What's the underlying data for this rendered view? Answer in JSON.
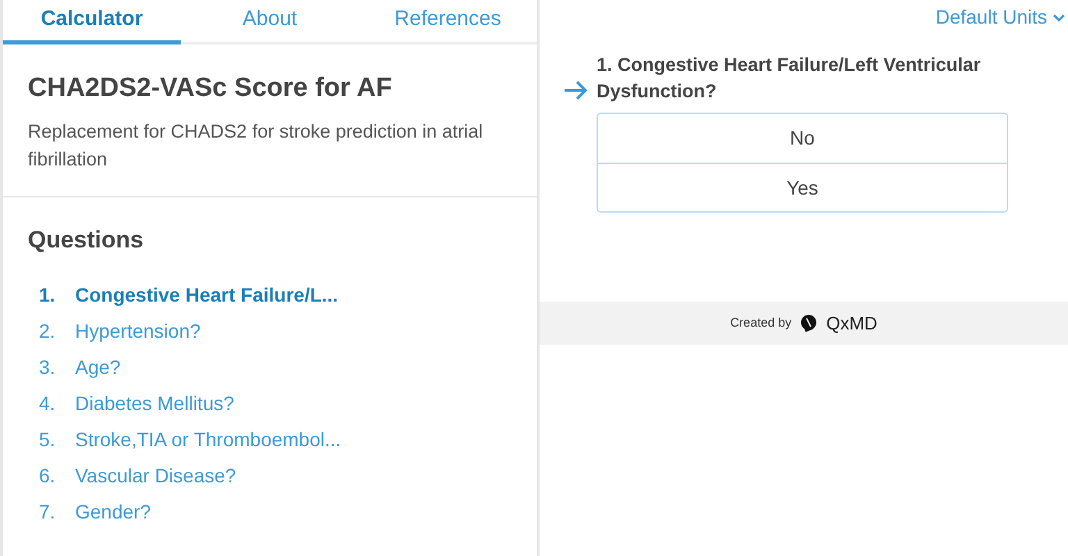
{
  "tabs": [
    {
      "label": "Calculator",
      "selected": true
    },
    {
      "label": "About",
      "selected": false
    },
    {
      "label": "References",
      "selected": false
    }
  ],
  "calculator": {
    "title": "CHA2DS2-VASc Score for AF",
    "description": "Replacement for CHADS2 for stroke prediction in atrial fibrillation"
  },
  "questions": {
    "heading": "Questions",
    "items": [
      {
        "number": "1.",
        "label": "Congestive Heart Failure/L...",
        "selected": true
      },
      {
        "number": "2.",
        "label": "Hypertension?",
        "selected": false
      },
      {
        "number": "3.",
        "label": "Age?",
        "selected": false
      },
      {
        "number": "4.",
        "label": "Diabetes Mellitus?",
        "selected": false
      },
      {
        "number": "5.",
        "label": "Stroke,TIA or Thromboembol...",
        "selected": false
      },
      {
        "number": "6.",
        "label": "Vascular Disease?",
        "selected": false
      },
      {
        "number": "7.",
        "label": "Gender?",
        "selected": false
      }
    ]
  },
  "units_menu": {
    "label": "Default Units"
  },
  "current_question": {
    "text": "1. Congestive Heart Failure/Left Ventricular Dysfunction?",
    "options": [
      {
        "label": "No",
        "selected": false
      },
      {
        "label": "Yes",
        "selected": false
      }
    ]
  },
  "footer": {
    "created_by": "Created by",
    "brand": "QxMD"
  }
}
